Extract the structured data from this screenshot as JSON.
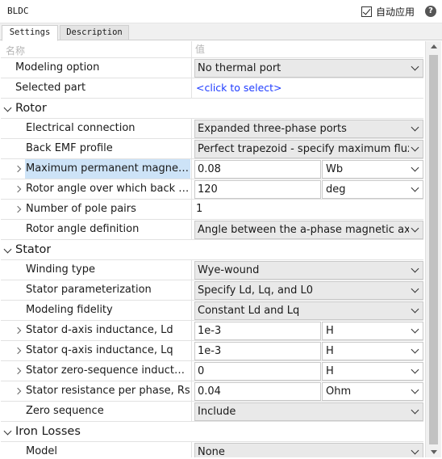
{
  "window": {
    "title": "BLDC",
    "auto_apply_label": "自动应用",
    "auto_apply_checked": true
  },
  "tabs": [
    {
      "label": "Settings",
      "active": true
    },
    {
      "label": "Description",
      "active": false
    }
  ],
  "grid": {
    "name_header": "名称",
    "value_header": "值",
    "rows": [
      {
        "kind": "param",
        "name": "Modeling option",
        "control": "dropdown",
        "value": "No thermal port"
      },
      {
        "kind": "param",
        "name": "Selected part",
        "control": "link",
        "value": "<click to select>"
      },
      {
        "kind": "section",
        "name": "Rotor"
      },
      {
        "kind": "param",
        "name": "Electrical connection",
        "control": "dropdown",
        "value": "Expanded three-phase ports"
      },
      {
        "kind": "param",
        "name": "Back EMF profile",
        "control": "dropdown",
        "value": "Perfect trapezoid - specify maximum flux linka"
      },
      {
        "kind": "param",
        "name": "Maximum permanent magnet flu...",
        "control": "text-unit",
        "value": "0.08",
        "unit": "Wb",
        "expandable": true,
        "selected": true
      },
      {
        "kind": "param",
        "name": "Rotor angle over which back em...",
        "control": "text-unit",
        "value": "120",
        "unit": "deg",
        "expandable": true
      },
      {
        "kind": "param",
        "name": "Number of pole pairs",
        "control": "plain",
        "value": "1",
        "expandable": true
      },
      {
        "kind": "param",
        "name": "Rotor angle definition",
        "control": "dropdown",
        "value": "Angle between the a-phase magnetic axis and"
      },
      {
        "kind": "section",
        "name": "Stator"
      },
      {
        "kind": "param",
        "name": "Winding type",
        "control": "dropdown",
        "value": "Wye-wound"
      },
      {
        "kind": "param",
        "name": "Stator parameterization",
        "control": "dropdown",
        "value": "Specify Ld, Lq, and L0"
      },
      {
        "kind": "param",
        "name": "Modeling fidelity",
        "control": "dropdown",
        "value": "Constant Ld and Lq"
      },
      {
        "kind": "param",
        "name": "Stator d-axis inductance, Ld",
        "control": "text-unit",
        "value": "1e-3",
        "unit": "H",
        "expandable": true
      },
      {
        "kind": "param",
        "name": "Stator q-axis inductance, Lq",
        "control": "text-unit",
        "value": "1e-3",
        "unit": "H",
        "expandable": true
      },
      {
        "kind": "param",
        "name": "Stator zero-sequence inductance...",
        "control": "text-unit",
        "value": "0",
        "unit": "H",
        "expandable": true
      },
      {
        "kind": "param",
        "name": "Stator resistance per phase, Rs",
        "control": "text-unit",
        "value": "0.04",
        "unit": "Ohm",
        "expandable": true
      },
      {
        "kind": "param",
        "name": "Zero sequence",
        "control": "dropdown",
        "value": "Include"
      },
      {
        "kind": "section",
        "name": "Iron Losses"
      },
      {
        "kind": "param",
        "name": "Model",
        "control": "dropdown",
        "value": "None"
      }
    ]
  }
}
